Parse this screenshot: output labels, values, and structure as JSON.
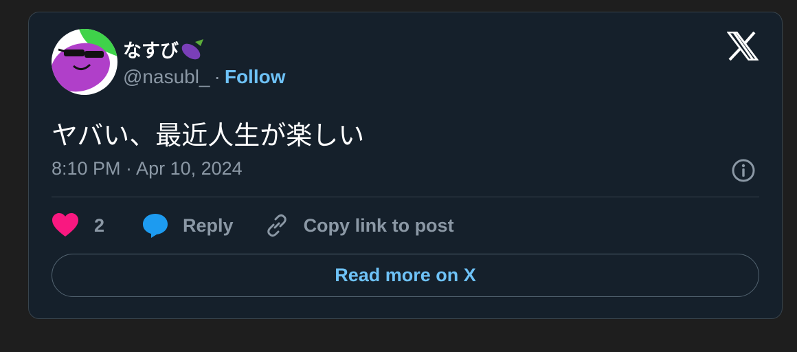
{
  "author": {
    "display_name": "なすび",
    "name_emoji": "eggplant-emoji",
    "handle": "@nasubl_",
    "separator": "·",
    "follow_label": "Follow"
  },
  "post": {
    "text": "ヤバい、最近人生が楽しい",
    "timestamp": "8:10 PM · Apr 10, 2024"
  },
  "actions": {
    "like_count": "2",
    "reply_label": "Reply",
    "copy_label": "Copy link to post"
  },
  "read_more_label": "Read more on X",
  "colors": {
    "card_bg": "#15202b",
    "border": "#38444d",
    "accent": "#6ec2f7",
    "like": "#f91880",
    "reply": "#1d9bf0",
    "muted": "#8b98a5"
  }
}
